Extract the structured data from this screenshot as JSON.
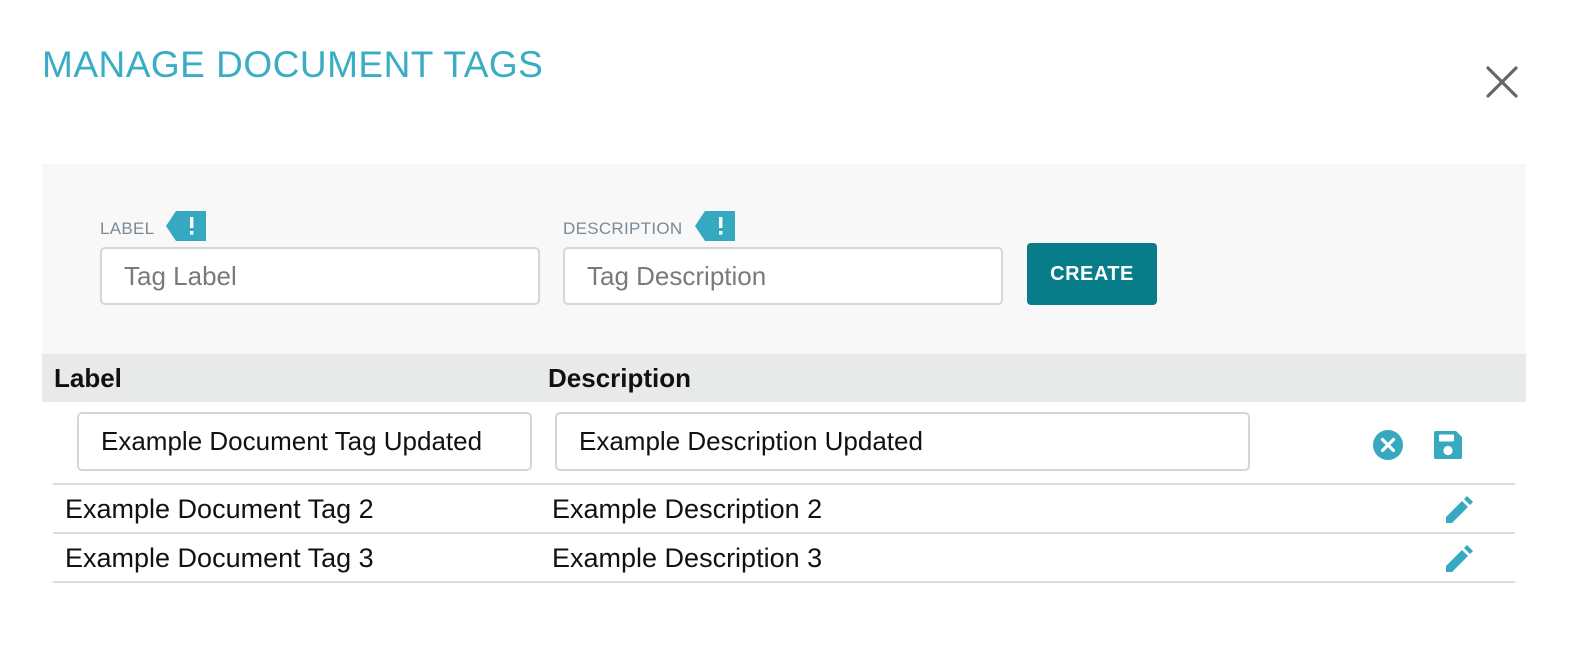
{
  "dialog": {
    "title": "MANAGE DOCUMENT TAGS",
    "close_icon": "close-icon"
  },
  "create_form": {
    "label_field": {
      "label": "LABEL",
      "placeholder": "Tag Label",
      "value": "",
      "required_icon": "exclamation-flag-icon"
    },
    "description_field": {
      "label": "DESCRIPTION",
      "placeholder": "Tag Description",
      "value": "",
      "required_icon": "exclamation-flag-icon"
    },
    "create_button_label": "CREATE"
  },
  "table": {
    "columns": [
      "Label",
      "Description"
    ],
    "editing_row": {
      "label_value": "Example Document Tag Updated",
      "description_value": "Example Description Updated",
      "cancel_icon": "cancel-circle-icon",
      "save_icon": "save-floppy-icon"
    },
    "rows": [
      {
        "label": "Example Document Tag 2",
        "description": "Example Description 2",
        "action_icon": "pencil-icon"
      },
      {
        "label": "Example Document Tag 3",
        "description": "Example Description 3",
        "action_icon": "pencil-icon"
      }
    ]
  },
  "colors": {
    "title": "#3aacc4",
    "accent": "#36a9c1",
    "create_button": "#087d8a",
    "panel_background": "#f8f8f8",
    "header_background": "#e8e9e9"
  }
}
